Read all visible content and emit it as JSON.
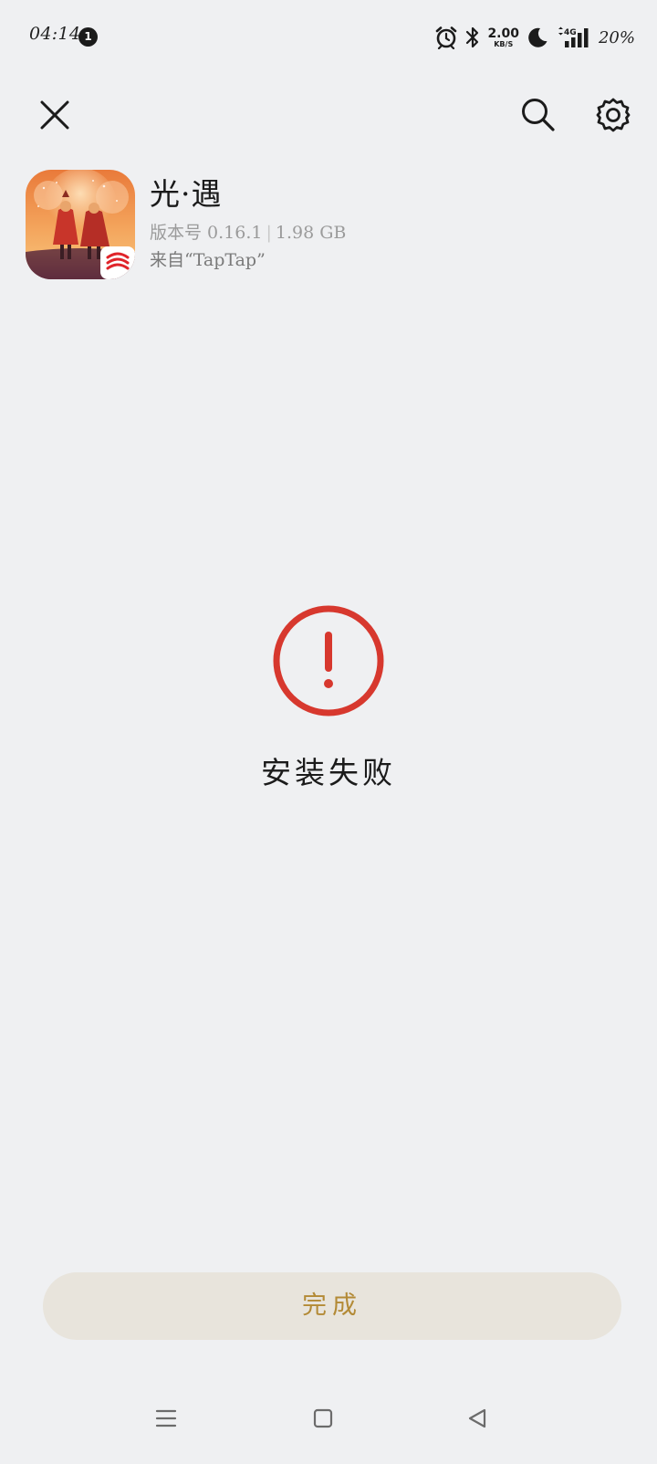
{
  "status_bar": {
    "time": "04:14",
    "notification_count": "1",
    "net_speed_value": "2.00",
    "net_speed_unit": "KB/S",
    "network_type": "4G",
    "battery": "20%",
    "icons": [
      "alarm-icon",
      "bluetooth-icon",
      "moon-icon",
      "signal-icon"
    ]
  },
  "top_bar": {
    "icons": [
      "close-icon",
      "search-icon",
      "gear-icon"
    ]
  },
  "app": {
    "name": "光·遇",
    "version_label": "版本号 0.16.1",
    "separator": "|",
    "size": "1.98 GB",
    "source": "来自“TapTap”"
  },
  "result": {
    "icon": "error-icon",
    "status_text": "安装失败",
    "accent_color": "#d7382e"
  },
  "actions": {
    "done_label": "完成",
    "done_text_color": "#b38a36",
    "done_bg_color": "#e8e4dc"
  },
  "nav_bar": {
    "icons": [
      "menu-icon",
      "home-icon",
      "back-icon"
    ]
  }
}
